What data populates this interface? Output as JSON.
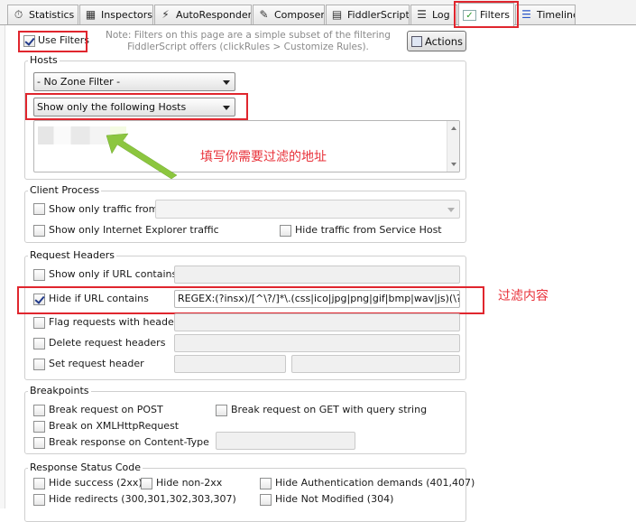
{
  "tabs": [
    {
      "label": "Statistics",
      "icon": "stopwatch-icon"
    },
    {
      "label": "Inspectors",
      "icon": "inspect-icon"
    },
    {
      "label": "AutoResponder",
      "icon": "lightning-icon"
    },
    {
      "label": "Composer",
      "icon": "pencil-icon"
    },
    {
      "label": "FiddlerScript",
      "icon": "script-icon"
    },
    {
      "label": "Log",
      "icon": "log-icon"
    },
    {
      "label": "Filters",
      "icon": "checkmark-icon"
    },
    {
      "label": "Timeline",
      "icon": "timeline-icon"
    }
  ],
  "active_tab": "Filters",
  "top": {
    "use_filters_label": "Use Filters",
    "use_filters_checked": true,
    "note_line1": "Note: Filters on this page are a simple subset of the filtering",
    "note_line2": "FiddlerScript offers (clickRules > Customize Rules).",
    "actions_label": "Actions"
  },
  "hosts": {
    "title": "Hosts",
    "zone_filter": "- No Zone Filter -",
    "host_mode": "Show only the following Hosts",
    "annotation": "填写你需要过滤的地址"
  },
  "client_process": {
    "title": "Client Process",
    "show_only_traffic_from": "Show only traffic from",
    "show_only_ie": "Show only Internet Explorer traffic",
    "hide_service_host": "Hide traffic from Service Host"
  },
  "request_headers": {
    "title": "Request Headers",
    "show_only_url": "Show only if URL contains",
    "hide_if_url": "Hide if URL contains",
    "hide_if_url_checked": true,
    "hide_if_url_value": "REGEX:(?insx)/[^\\?/]*\\.(css|ico|jpg|png|gif|bmp|wav|js)(\\?.*)?$",
    "flag_requests": "Flag requests with headers",
    "delete_headers": "Delete request headers",
    "set_header": "Set request header",
    "annotation": "过滤内容"
  },
  "breakpoints": {
    "title": "Breakpoints",
    "break_post": "Break request on POST",
    "break_get_query": "Break request on GET with query string",
    "break_xhr": "Break on XMLHttpRequest",
    "break_content_type": "Break response on Content-Type"
  },
  "response_status": {
    "title": "Response Status Code",
    "hide_success": "Hide success (2xx)",
    "hide_non_2xx": "Hide non-2xx",
    "hide_auth": "Hide Authentication demands (401,407)",
    "hide_redirects": "Hide redirects (300,301,302,303,307)",
    "hide_not_modified": "Hide Not Modified (304)"
  },
  "colors": {
    "highlight": "#e0262e",
    "annotation_text": "#e8323a",
    "arrow": "#8cc63f"
  }
}
